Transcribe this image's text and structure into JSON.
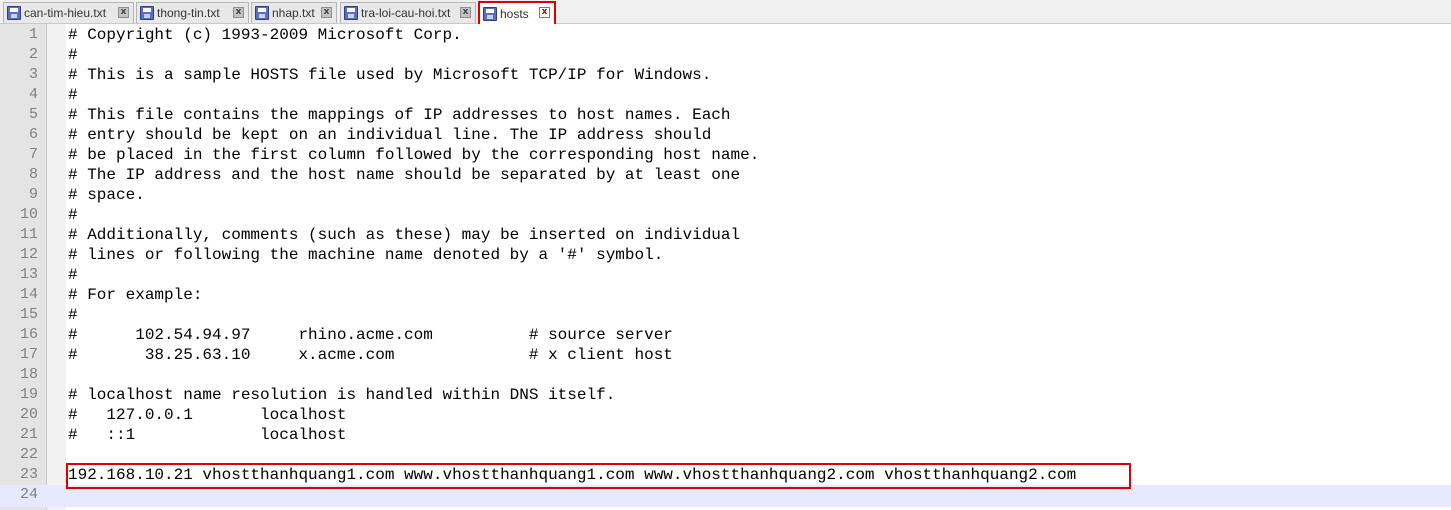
{
  "tabs": [
    {
      "label": "can-tim-hieu.txt",
      "icon": "floppy-disk-icon",
      "close": "x",
      "active": false
    },
    {
      "label": "thong-tin.txt",
      "icon": "floppy-disk-icon",
      "close": "x",
      "active": false
    },
    {
      "label": "nhap.txt",
      "icon": "floppy-disk-icon",
      "close": "x",
      "active": false
    },
    {
      "label": "tra-loi-cau-hoi.txt",
      "icon": "floppy-disk-icon",
      "close": "x",
      "active": false
    },
    {
      "label": "hosts",
      "icon": "floppy-disk-icon",
      "close": "x",
      "active": true
    }
  ],
  "editor": {
    "current_line": 24,
    "highlighted_line": 23,
    "colors": {
      "highlight": "#e00000",
      "current_line": "#e8e8ff",
      "gutter": "#e4e4e4"
    },
    "lines": [
      {
        "num": "1",
        "text": "# Copyright (c) 1993-2009 Microsoft Corp."
      },
      {
        "num": "2",
        "text": "#"
      },
      {
        "num": "3",
        "text": "# This is a sample HOSTS file used by Microsoft TCP/IP for Windows."
      },
      {
        "num": "4",
        "text": "#"
      },
      {
        "num": "5",
        "text": "# This file contains the mappings of IP addresses to host names. Each"
      },
      {
        "num": "6",
        "text": "# entry should be kept on an individual line. The IP address should"
      },
      {
        "num": "7",
        "text": "# be placed in the first column followed by the corresponding host name."
      },
      {
        "num": "8",
        "text": "# The IP address and the host name should be separated by at least one"
      },
      {
        "num": "9",
        "text": "# space."
      },
      {
        "num": "10",
        "text": "#"
      },
      {
        "num": "11",
        "text": "# Additionally, comments (such as these) may be inserted on individual"
      },
      {
        "num": "12",
        "text": "# lines or following the machine name denoted by a '#' symbol."
      },
      {
        "num": "13",
        "text": "#"
      },
      {
        "num": "14",
        "text": "# For example:"
      },
      {
        "num": "15",
        "text": "#"
      },
      {
        "num": "16",
        "text": "#      102.54.94.97     rhino.acme.com          # source server"
      },
      {
        "num": "17",
        "text": "#       38.25.63.10     x.acme.com              # x client host"
      },
      {
        "num": "18",
        "text": ""
      },
      {
        "num": "19",
        "text": "# localhost name resolution is handled within DNS itself."
      },
      {
        "num": "20",
        "text": "#   127.0.0.1       localhost"
      },
      {
        "num": "21",
        "text": "#   ::1             localhost"
      },
      {
        "num": "22",
        "text": ""
      },
      {
        "num": "23",
        "text": "192.168.10.21 vhostthanhquang1.com www.vhostthanhquang1.com www.vhostthanhquang2.com vhostthanhquang2.com"
      },
      {
        "num": "24",
        "text": ""
      }
    ]
  }
}
